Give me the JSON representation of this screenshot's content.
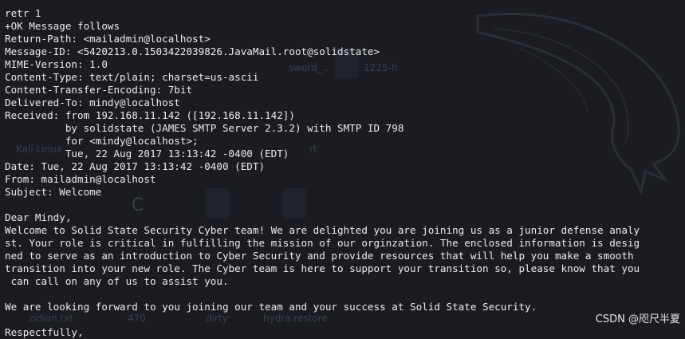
{
  "terminal": {
    "lines": [
      "",
      "retr 1",
      "+OK Message follows",
      "Return-Path: <mailadmin@localhost>",
      "Message-ID: <5420213.0.1503422039826.JavaMail.root@solidstate>",
      "MIME-Version: 1.0",
      "Content-Type: text/plain; charset=us-ascii",
      "Content-Transfer-Encoding: 7bit",
      "Delivered-To: mindy@localhost",
      "Received: from 192.168.11.142 ([192.168.11.142])",
      "          by solidstate (JAMES SMTP Server 2.3.2) with SMTP ID 798",
      "          for <mindy@localhost>;",
      "          Tue, 22 Aug 2017 13:13:42 -0400 (EDT)",
      "Date: Tue, 22 Aug 2017 13:13:42 -0400 (EDT)",
      "From: mailadmin@localhost",
      "Subject: Welcome",
      "",
      "Dear Mindy,",
      "Welcome to Solid State Security Cyber team! We are delighted you are joining us as a junior defense analy",
      "st. Your role is critical in fulfilling the mission of our orginzation. The enclosed information is desig",
      "ned to serve as an introduction to Cyber Security and provide resources that will help you make a smooth",
      "transition into your new role. The Cyber team is here to support your transition so, please know that you",
      " can call on any of us to assist you.",
      "",
      "We are looking forward to you joining our team and your success at Solid State Security.",
      "",
      "Respectfully,"
    ]
  },
  "background": {
    "labels": [
      "sword_..",
      "1225-h",
      "Kali Linux",
      "rt",
      "C",
      "zidian.txt",
      "470",
      "dirty",
      "hydra.restore"
    ]
  },
  "watermark": "CSDN @咫尺半夏"
}
